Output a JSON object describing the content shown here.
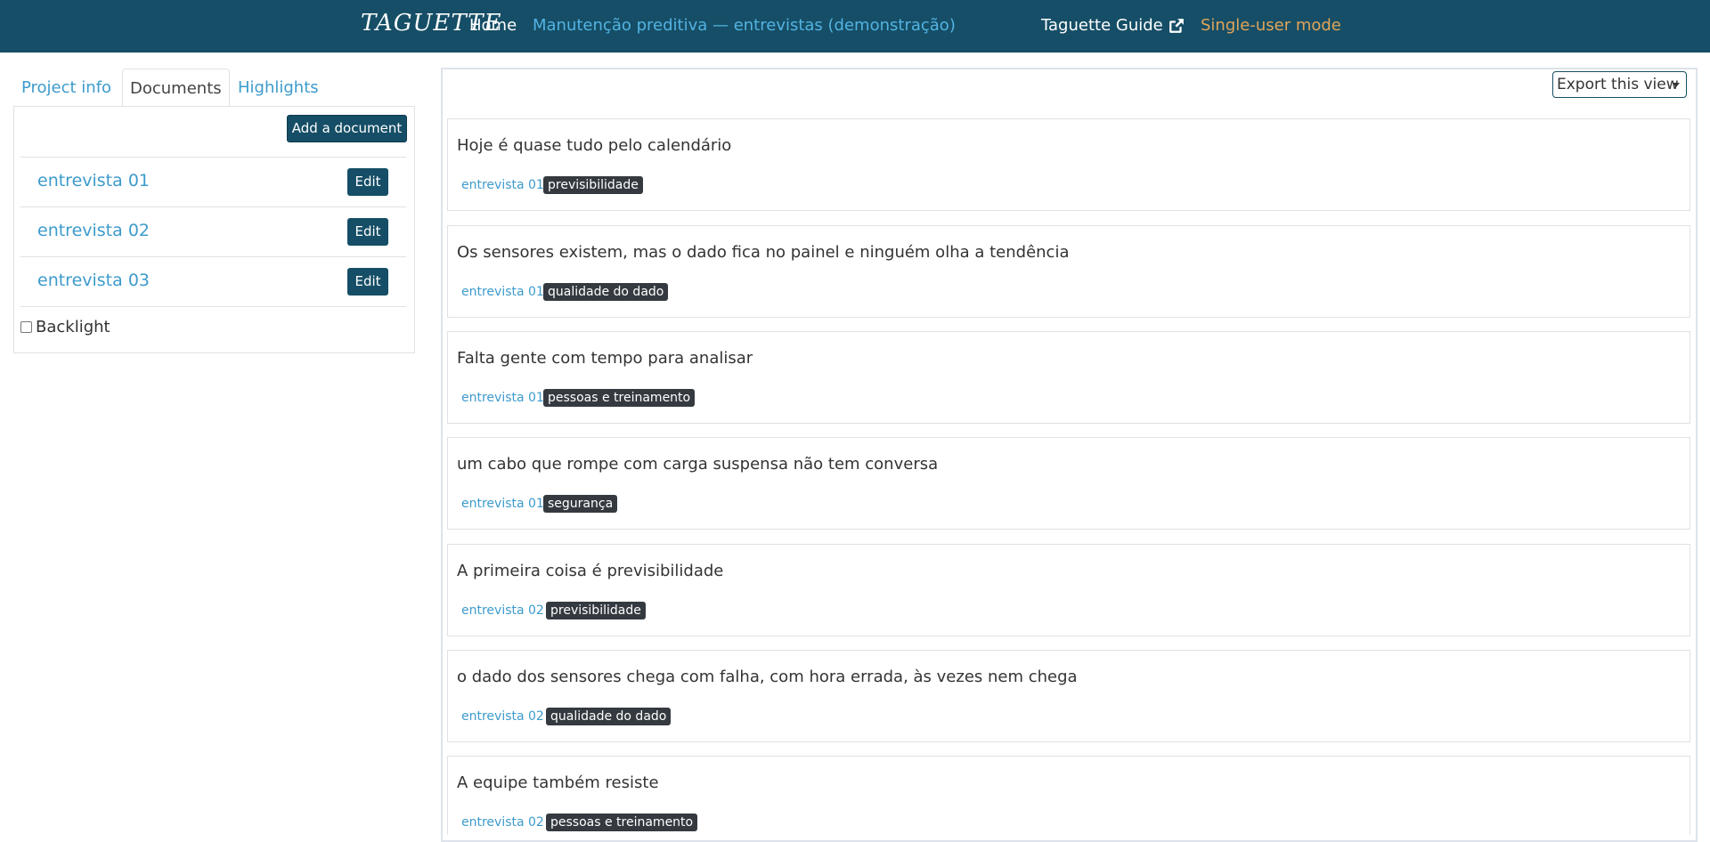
{
  "navbar": {
    "brand": "TAGUETTE",
    "home": "Home",
    "project": "Manutenção preditiva — entrevistas (demonstração)",
    "guide": "Taguette Guide",
    "mode": "Single-user mode",
    "colors": {
      "background": "#154e66",
      "link": "#53b3e3",
      "mode": "#e0a45a"
    }
  },
  "tabs": [
    {
      "label": "Project info",
      "active": false
    },
    {
      "label": "Documents",
      "active": true
    },
    {
      "label": "Highlights",
      "active": false
    }
  ],
  "documents": {
    "add_label": "Add a document",
    "edit_label": "Edit",
    "items": [
      "entrevista 01",
      "entrevista 02",
      "entrevista 03"
    ],
    "backlight_label": "Backlight",
    "backlight_checked": false
  },
  "export": {
    "label": "Export this view"
  },
  "highlights": [
    {
      "text": "Hoje é quase tudo pelo calendário",
      "document": "entrevista 01",
      "tag": "previsibilidade"
    },
    {
      "text": "Os sensores existem, mas o dado fica no painel e ninguém olha a tendência",
      "document": "entrevista 01",
      "tag": "qualidade do dado"
    },
    {
      "text": "Falta gente com tempo para analisar",
      "document": "entrevista 01",
      "tag": "pessoas e treinamento"
    },
    {
      "text": "um cabo que rompe com carga suspensa não tem conversa",
      "document": "entrevista 01",
      "tag": "segurança"
    },
    {
      "text": "A primeira coisa é previsibilidade",
      "document": "entrevista 02",
      "tag": "previsibilidade"
    },
    {
      "text": "o dado dos sensores chega com falha, com hora errada, às vezes nem chega",
      "document": "entrevista 02",
      "tag": "qualidade do dado"
    },
    {
      "text": "A equipe também resiste",
      "document": "entrevista 02",
      "tag": "pessoas e treinamento"
    }
  ]
}
